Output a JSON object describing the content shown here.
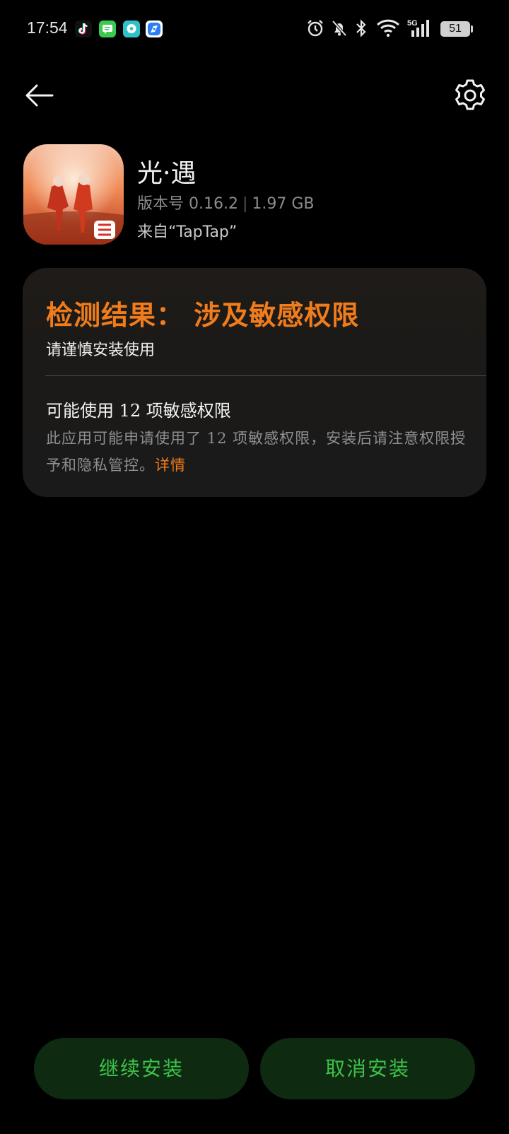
{
  "status_bar": {
    "time": "17:54",
    "battery": "51",
    "battery_level": 0.51,
    "network": "5G",
    "notification_apps": [
      "tiktok-icon",
      "messages-icon",
      "chat-icon",
      "browser-icon"
    ],
    "status_icons": [
      "alarm-icon",
      "bell-off-icon",
      "bluetooth-icon",
      "wifi-icon",
      "cellular-5g-icon",
      "battery-icon"
    ]
  },
  "top_bar": {
    "back_icon": "arrow-left-icon",
    "settings_icon": "gear-icon"
  },
  "app": {
    "name": "光·遇",
    "version_label": "版本号 0.16.2",
    "size": "1.97 GB",
    "source": "来自“TapTap”"
  },
  "result_card": {
    "title": "检测结果： 涉及敏感权限",
    "subtitle": "请谨慎安装使用",
    "permission_title": "可能使用 12 项敏感权限",
    "permission_desc": "此应用可能申请使用了 12 项敏感权限，安装后请注意权限授予和隐私管控。",
    "details_link": "详情",
    "accent_color": "#f07c1c"
  },
  "buttons": {
    "continue_label": "继续安装",
    "cancel_label": "取消安装",
    "text_color": "#3dc24a",
    "background_color": "#0e2a10"
  }
}
